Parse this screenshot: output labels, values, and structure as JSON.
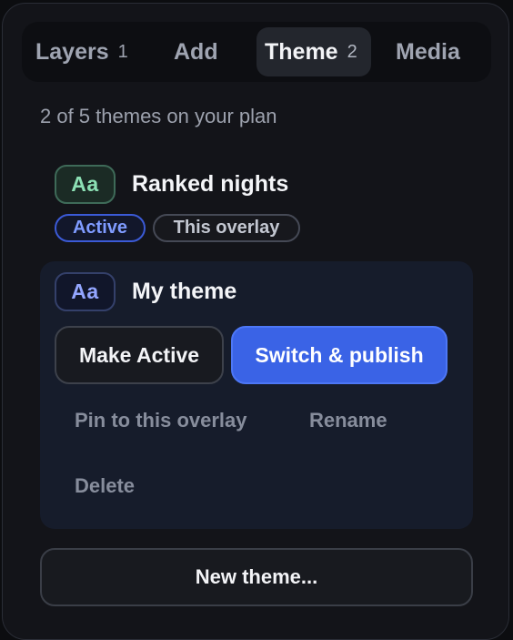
{
  "tabs": [
    {
      "label": "Layers",
      "count": "1"
    },
    {
      "label": "Add"
    },
    {
      "label": "Theme",
      "count": "2"
    },
    {
      "label": "Media"
    }
  ],
  "active_tab": "Theme",
  "plan_text": "2 of 5 themes on your plan",
  "themes": [
    {
      "badge": "Aa",
      "name": "Ranked nights",
      "badge_color": "#8ce0b4",
      "pills": [
        "Active",
        "This overlay"
      ]
    },
    {
      "badge": "Aa",
      "name": "My theme",
      "badge_color": "#93a6ff",
      "actions": {
        "make_active": "Make Active",
        "switch_publish": "Switch & publish",
        "pin": "Pin to this overlay",
        "rename": "Rename",
        "delete": "Delete"
      }
    }
  ],
  "new_theme_label": "New theme...",
  "colors": {
    "accent": "#3a63e6",
    "active_pill": "#7f9bff",
    "background": "#131419"
  }
}
